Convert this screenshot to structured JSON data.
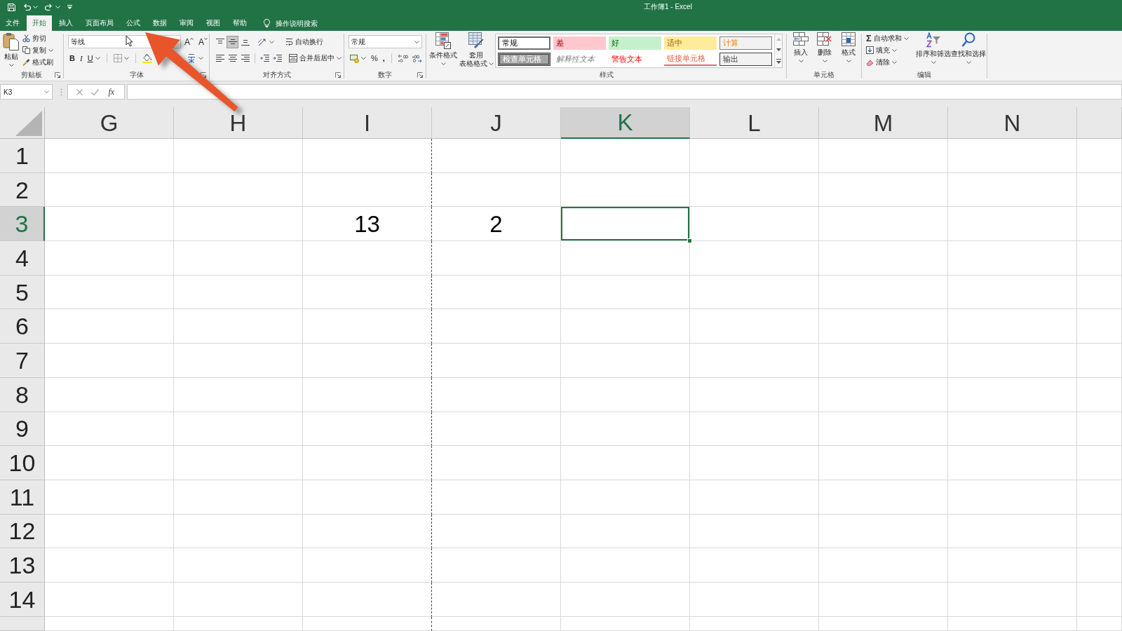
{
  "window": {
    "title": "工作簿1 - Excel"
  },
  "tabs": [
    {
      "label": "文件",
      "selected": false
    },
    {
      "label": "开始",
      "selected": true
    },
    {
      "label": "插入",
      "selected": false
    },
    {
      "label": "页面布局",
      "selected": false
    },
    {
      "label": "公式",
      "selected": false
    },
    {
      "label": "数据",
      "selected": false
    },
    {
      "label": "审阅",
      "selected": false
    },
    {
      "label": "视图",
      "selected": false
    },
    {
      "label": "帮助",
      "selected": false
    }
  ],
  "tell_me": {
    "label": "操作说明搜索"
  },
  "ribbon": {
    "clipboard": {
      "label": "剪贴板",
      "paste": "粘贴",
      "cut": "剪切",
      "copy": "复制",
      "format_painter": "格式刷"
    },
    "font": {
      "label": "字体",
      "font_name": "等线",
      "grow_font": "A",
      "shrink_font": "A",
      "bold": "B",
      "italic": "I",
      "underline": "U"
    },
    "alignment": {
      "label": "对齐方式",
      "vertical_align": [
        {
          "selected": false
        },
        {
          "selected": true
        },
        {
          "selected": false
        }
      ],
      "horizontal_align": [
        {
          "selected": false
        },
        {
          "selected": false
        },
        {
          "selected": false
        }
      ],
      "wrap_text": "自动换行",
      "merge_center": "合并后居中"
    },
    "number": {
      "label": "数字",
      "format": "常规",
      "percent": "%",
      "comma": ","
    },
    "styles": {
      "label": "样式",
      "conditional_formatting": "条件格式",
      "format_as_table": [
        "套用",
        "表格格式"
      ],
      "cell_styles": [
        {
          "kind": "normal",
          "label": "常规",
          "selected": true
        },
        {
          "kind": "bad",
          "label": "差",
          "selected": false
        },
        {
          "kind": "good",
          "label": "好",
          "selected": false
        },
        {
          "kind": "neutral",
          "label": "适中",
          "selected": false
        },
        {
          "kind": "calculation",
          "label": "计算",
          "selected": false
        },
        {
          "kind": "check",
          "label": "检查单元格",
          "selected": false
        },
        {
          "kind": "explanatory",
          "label": "解释性文本",
          "selected": false
        },
        {
          "kind": "warning",
          "label": "警告文本",
          "selected": false
        },
        {
          "kind": "linked",
          "label": "链接单元格",
          "selected": false
        },
        {
          "kind": "output",
          "label": "输出",
          "selected": false
        }
      ]
    },
    "cells": {
      "label": "单元格",
      "insert": "插入",
      "delete": "删除",
      "format": "格式"
    },
    "editing": {
      "label": "编辑",
      "autosum_symbol": "Σ",
      "autosum": "自动求和",
      "fill": "填充",
      "clear": "清除",
      "sort_filter": "排序和筛选",
      "find_select": "查找和选择"
    }
  },
  "formula_bar": {
    "name_box": "K3",
    "function_button": "fx"
  },
  "grid": {
    "columns": [
      {
        "label": "G",
        "selected": false,
        "page_break": false
      },
      {
        "label": "H",
        "selected": false,
        "page_break": false
      },
      {
        "label": "I",
        "selected": false,
        "page_break": true
      },
      {
        "label": "J",
        "selected": false,
        "page_break": false
      },
      {
        "label": "K",
        "selected": true,
        "page_break": false
      },
      {
        "label": "L",
        "selected": false,
        "page_break": false
      },
      {
        "label": "M",
        "selected": false,
        "page_break": false
      },
      {
        "label": "N",
        "selected": false,
        "page_break": false
      }
    ],
    "rows": [
      {
        "label": "1",
        "selected": false
      },
      {
        "label": "2",
        "selected": false
      },
      {
        "label": "3",
        "selected": true,
        "cells": [
          null,
          null,
          "13",
          "2",
          null,
          null,
          null,
          null
        ]
      },
      {
        "label": "4",
        "selected": false
      },
      {
        "label": "5",
        "selected": false
      },
      {
        "label": "6",
        "selected": false
      },
      {
        "label": "7",
        "selected": false
      },
      {
        "label": "8",
        "selected": false
      },
      {
        "label": "9",
        "selected": false
      },
      {
        "label": "10",
        "selected": false
      },
      {
        "label": "11",
        "selected": false
      },
      {
        "label": "12",
        "selected": false
      },
      {
        "label": "13",
        "selected": false
      },
      {
        "label": "14",
        "selected": false
      }
    ]
  }
}
